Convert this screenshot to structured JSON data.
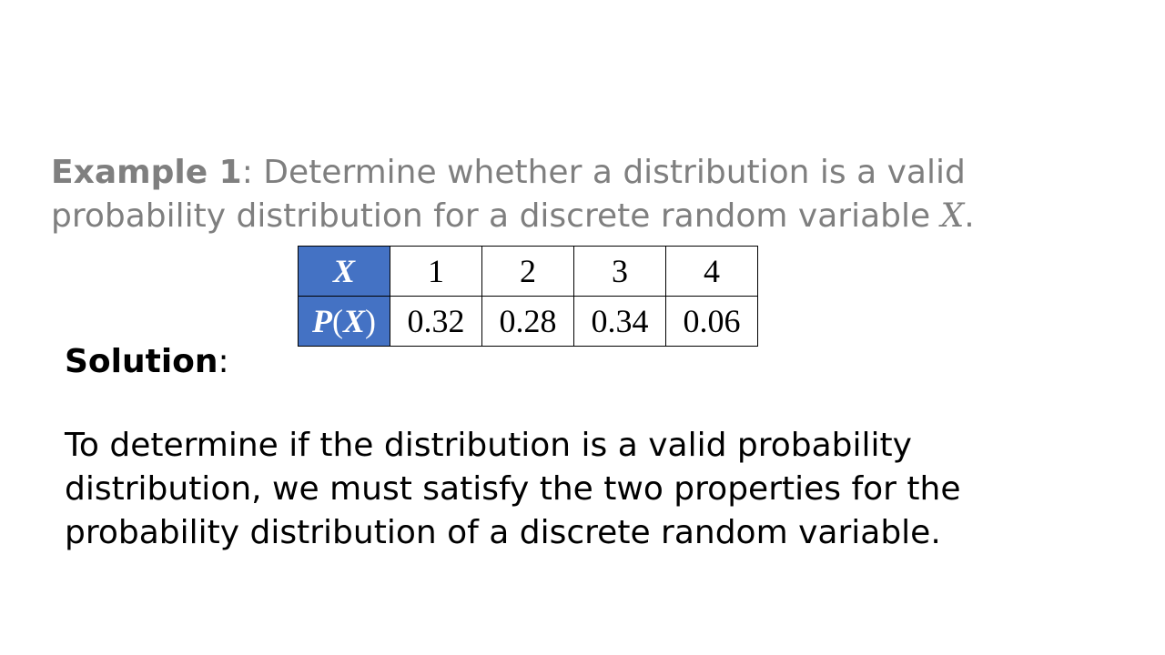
{
  "example": {
    "label": "Example 1",
    "text_before": ": Determine whether a distribution is a valid probability distribution for a discrete random variable ",
    "variable": "X",
    "text_after": "."
  },
  "table": {
    "row1_header": "X",
    "row2_header_letter": "P",
    "row2_header_open": "(",
    "row2_header_var": "X",
    "row2_header_close": ")",
    "x_values": [
      "1",
      "2",
      "3",
      "4"
    ],
    "p_values": [
      "0.32",
      "0.28",
      "0.34",
      "0.06"
    ],
    "header_color": "#4472c4"
  },
  "solution": {
    "label": "Solution",
    "colon": ":",
    "text": "To determine if the distribution is a valid probability distribution, we must satisfy the two properties for the probability distribution of a discrete random variable."
  }
}
